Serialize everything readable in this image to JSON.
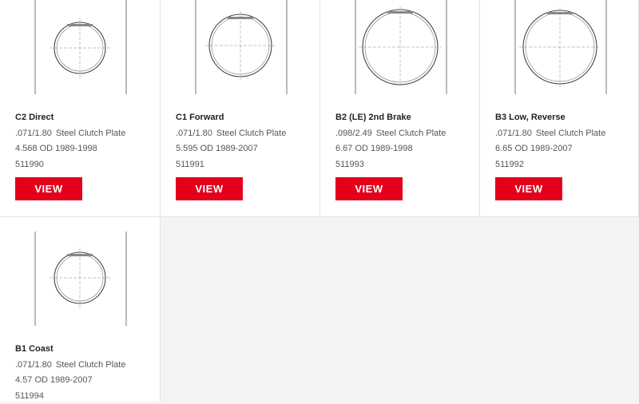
{
  "products": [
    {
      "name": "C2 Direct",
      "thickness": ".071/1.80",
      "type": "Steel Clutch Plate",
      "od": "4.568",
      "od_label": "OD",
      "years": "1989-1998",
      "part_number": "511990",
      "button": "VIEW"
    },
    {
      "name": "C1 Forward",
      "thickness": ".071/1.80",
      "type": "Steel Clutch Plate",
      "od": "5.595",
      "od_label": "OD",
      "years": "1989-2007",
      "part_number": "511991",
      "button": "VIEW"
    },
    {
      "name": "B2 (LE) 2nd Brake",
      "thickness": ".098/2.49",
      "type": "Steel Clutch Plate",
      "od": "6.67",
      "od_label": "OD",
      "years": "1989-1998",
      "part_number": "511993",
      "button": "VIEW"
    },
    {
      "name": "B3 Low, Reverse",
      "thickness": ".071/1.80",
      "type": "Steel Clutch Plate",
      "od": "6.65",
      "od_label": "OD",
      "years": "1989-2007",
      "part_number": "511992",
      "button": "VIEW"
    },
    {
      "name": "B1 Coast",
      "thickness": ".071/1.80",
      "type": "Steel Clutch Plate",
      "od": "4.57",
      "od_label": "OD",
      "years": "1989-2007",
      "part_number": "511994"
    }
  ],
  "colors": {
    "button_bg": "#e3001b",
    "page_bg": "#f4f4f4",
    "card_bg": "#ffffff"
  },
  "icons": {
    "drawing": "clutch-plate-drawing-icon"
  }
}
